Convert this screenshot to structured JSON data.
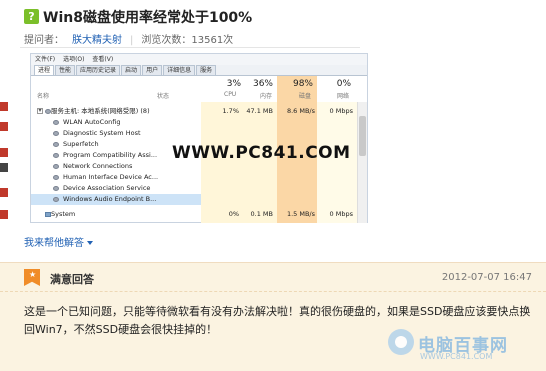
{
  "question": {
    "badge": "?",
    "title": "Win8磁盘使用率经常处于100%",
    "asker_label": "提问者：",
    "asker": "朕大精夫射",
    "views_label": "浏览次数：13561次"
  },
  "screenshot": {
    "menu": [
      "文件(F)",
      "选项(O)",
      "查看(V)"
    ],
    "tabs": [
      "进程",
      "性能",
      "应用历史记录",
      "启动",
      "用户",
      "详细信息",
      "服务"
    ],
    "active_tab": "进程",
    "columns": {
      "name": "名称",
      "status": "状态",
      "cpu_pct": "3%",
      "cpu": "CPU",
      "mem_pct": "36%",
      "mem": "内存",
      "disk_pct": "98%",
      "disk": "磁盘",
      "net_pct": "0%",
      "net": "网络"
    },
    "rows": [
      {
        "name": "服务主机: 本地系统(网络受限) (8)",
        "cpu": "1.7%",
        "mem": "47.1 MB",
        "disk": "8.6 MB/s",
        "net": "0 Mbps"
      },
      {
        "name": "WLAN AutoConfig"
      },
      {
        "name": "Diagnostic System Host"
      },
      {
        "name": "Superfetch"
      },
      {
        "name": "Program Compatibility Assi..."
      },
      {
        "name": "Network Connections"
      },
      {
        "name": "Human Interface Device Ac..."
      },
      {
        "name": "Device Association Service"
      },
      {
        "name": "Windows Audio Endpoint B..."
      },
      {
        "name": "System",
        "cpu": "0%",
        "mem": "0.1 MB",
        "disk": "1.5 MB/s",
        "net": "0 Mbps"
      }
    ],
    "watermark": "WWW.PC841.COM"
  },
  "help_link": "我来帮他解答",
  "answer": {
    "label": "满意回答",
    "time": "2012-07-07 16:47",
    "body": "这是一个已知问题，只能等待微软看有没有办法解决啦！真的很伤硬盘的，如果是SSD硬盘应该要快点换回Win7，不然SSD硬盘会很快挂掉的！"
  },
  "site_logo": {
    "name": "电脑百事网",
    "domain": "WWW.PC841.COM"
  },
  "colors": {
    "accent_link": "#2262b4",
    "disk_highlight": "#fbd7a6",
    "answer_bg": "#fbf3e1",
    "badge_green": "#7bbf2a",
    "flag_orange": "#f08c28"
  }
}
